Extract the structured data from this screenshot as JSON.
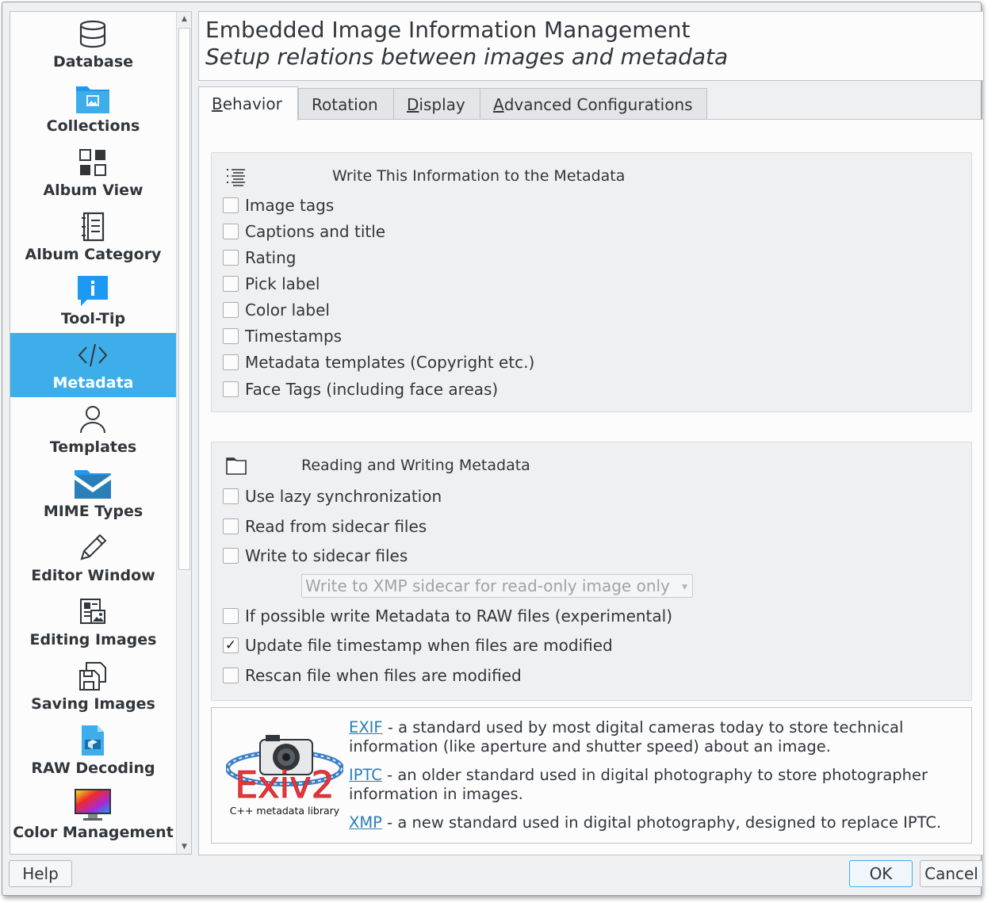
{
  "sidebar": {
    "items": [
      {
        "label": "Database",
        "icon": "database-icon"
      },
      {
        "label": "Collections",
        "icon": "folder-collections-icon"
      },
      {
        "label": "Album View",
        "icon": "album-view-icon"
      },
      {
        "label": "Album Category",
        "icon": "notebook-icon"
      },
      {
        "label": "Tool-Tip",
        "icon": "tooltip-icon"
      },
      {
        "label": "Metadata",
        "icon": "code-icon"
      },
      {
        "label": "Templates",
        "icon": "user-icon"
      },
      {
        "label": "MIME Types",
        "icon": "mail-folder-icon"
      },
      {
        "label": "Editor Window",
        "icon": "pencil-icon"
      },
      {
        "label": "Editing Images",
        "icon": "image-edit-icon"
      },
      {
        "label": "Saving Images",
        "icon": "save-icon"
      },
      {
        "label": "RAW Decoding",
        "icon": "raw-file-icon"
      },
      {
        "label": "Color Management",
        "icon": "color-monitor-icon"
      }
    ],
    "selected": "Metadata"
  },
  "header": {
    "title": "Embedded Image Information Management",
    "subtitle": "Setup relations between images and metadata"
  },
  "tabs": [
    {
      "label": "Behavior",
      "mnemonic": "B",
      "rest": "ehavior",
      "active": true
    },
    {
      "label": "Rotation",
      "mnemonic": "",
      "rest": "Rotation",
      "active": false
    },
    {
      "label": "Display",
      "mnemonic": "D",
      "rest": "isplay",
      "active": false
    },
    {
      "label": "Advanced Configurations",
      "mnemonic": "A",
      "rest": "dvanced Configurations",
      "active": false
    }
  ],
  "write_group": {
    "title": "Write This Information to the Metadata",
    "icon": "list-icon",
    "items": [
      {
        "label": "Image tags",
        "checked": false
      },
      {
        "label": "Captions and title",
        "checked": false
      },
      {
        "label": "Rating",
        "checked": false
      },
      {
        "label": "Pick label",
        "checked": false
      },
      {
        "label": "Color label",
        "checked": false
      },
      {
        "label": "Timestamps",
        "checked": false
      },
      {
        "label": "Metadata templates (Copyright etc.)",
        "checked": false
      },
      {
        "label": "Face Tags (including face areas)",
        "checked": false
      }
    ]
  },
  "rw_group": {
    "title": "Reading and Writing Metadata",
    "icon": "folder-icon",
    "items": [
      {
        "label": "Use lazy synchronization",
        "checked": false
      },
      {
        "label": "Read from sidecar files",
        "checked": false
      },
      {
        "label": "Write to sidecar files",
        "checked": false
      },
      {
        "label": "If possible write Metadata to RAW files (experimental)",
        "checked": false
      },
      {
        "label": "Update file timestamp when files are modified",
        "checked": true
      },
      {
        "label": "Rescan file when files are modified",
        "checked": false
      }
    ],
    "sidecar_combo": "Write to XMP sidecar for read-only image only"
  },
  "info": {
    "logo_text": "Exiv2",
    "logo_caption": "C++ metadata library",
    "exif_link": "EXIF",
    "exif_text_1": " - a standard used by most digital cameras today to store technical",
    "exif_text_2": "information (like aperture and shutter speed) about an image.",
    "iptc_link": "IPTC",
    "iptc_text_1": " - an older standard used in digital photography to store photographer",
    "iptc_text_2": "information in images.",
    "xmp_link": "XMP",
    "xmp_text": " - a new standard used in digital photography, designed to replace IPTC."
  },
  "buttons": {
    "help": "Help",
    "ok": "OK",
    "cancel": "Cancel"
  },
  "colors": {
    "accent": "#3daee9",
    "link": "#2980b9",
    "exiv_red": "#e8363c"
  }
}
